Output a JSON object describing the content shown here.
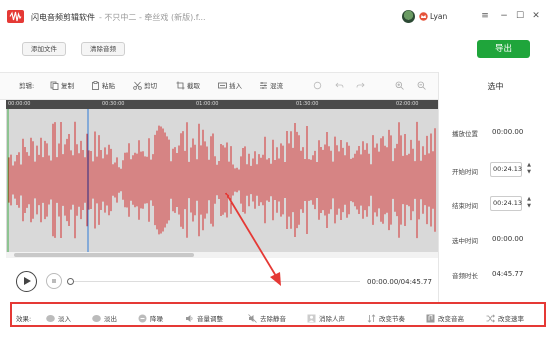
{
  "window": {
    "title": "闪电音频剪辑软件",
    "subtitle": "- 不只中二 - 牵丝戏 (新版).f...",
    "username": "Lyan"
  },
  "actions": {
    "add_file": "添加文件",
    "clear_audio": "清除音频",
    "export": "导出"
  },
  "toolbar": {
    "label": "剪辑:",
    "copy": "复制",
    "paste": "粘贴",
    "cut": "剪切",
    "crop": "截取",
    "insert": "插入",
    "mix": "混流"
  },
  "timeline": {
    "ticks": [
      "00:00:00",
      "00:30:00",
      "01:00:00",
      "01:30:00",
      "02:00:00"
    ]
  },
  "panel": {
    "title": "选中",
    "play_position_label": "播放位置",
    "play_position_value": "00:00.00",
    "start_label": "开始时间",
    "start_value": "00:24.13",
    "end_label": "结束时间",
    "end_value": "00:24.13",
    "selected_label": "选中时间",
    "selected_value": "00:00.00",
    "duration_label": "音频时长",
    "duration_value": "04:45.77"
  },
  "player": {
    "time": "00:00.00/04:45.77"
  },
  "effects": {
    "label": "效果:",
    "fade_in": "淡入",
    "fade_out": "淡出",
    "denoise": "降噪",
    "volume": "音量调整",
    "remove_silence": "去除静音",
    "remove_vocals": "消除人声",
    "change_tempo": "改变节奏",
    "change_pitch": "改变音高",
    "change_speed": "改变速率"
  },
  "colors": {
    "waveform": "#d32f2f",
    "export": "#1fa53b",
    "highlight": "#e53935",
    "playhead": "#2e7bd6"
  }
}
